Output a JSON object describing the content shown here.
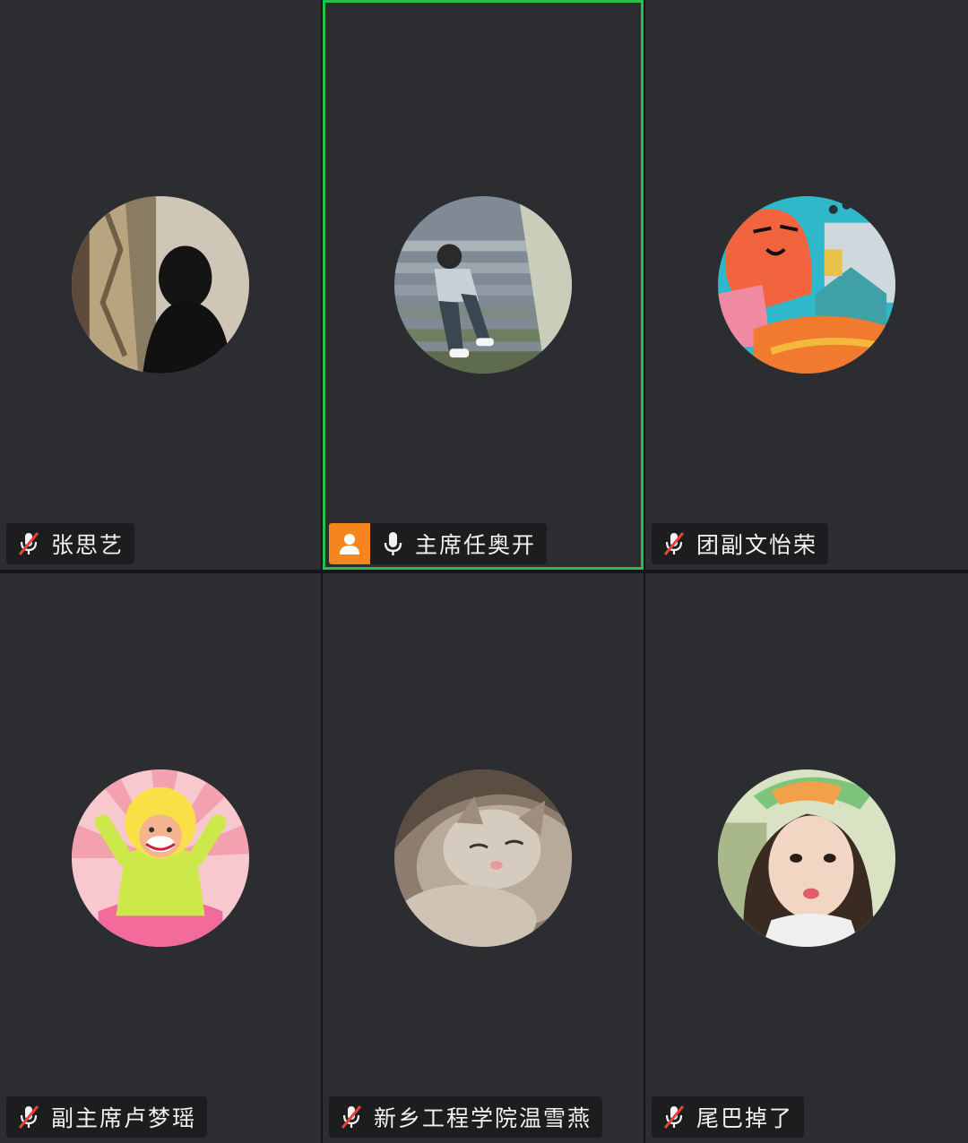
{
  "participants": [
    {
      "name": "张思艺",
      "muted": true,
      "host": false,
      "active": false,
      "avatar": "silhouette-girl-photo"
    },
    {
      "name": "主席任奥开",
      "muted": false,
      "host": true,
      "active": true,
      "avatar": "boy-on-stairs-photo"
    },
    {
      "name": "团副文怡荣",
      "muted": true,
      "host": false,
      "active": false,
      "avatar": "colorful-painting"
    },
    {
      "name": "副主席卢梦瑶",
      "muted": true,
      "host": false,
      "active": false,
      "avatar": "cartoon-cheering-kid"
    },
    {
      "name": "新乡工程学院温雪燕",
      "muted": true,
      "host": false,
      "active": false,
      "avatar": "sleeping-cat-photo"
    },
    {
      "name": "尾巴掉了",
      "muted": true,
      "host": false,
      "active": false,
      "avatar": "girl-with-hat-photo"
    }
  ],
  "colors": {
    "tile_bg": "#2b2d30",
    "active_border": "#27c04a",
    "host_badge": "#f7851d",
    "muted_slash": "#e8413c"
  }
}
